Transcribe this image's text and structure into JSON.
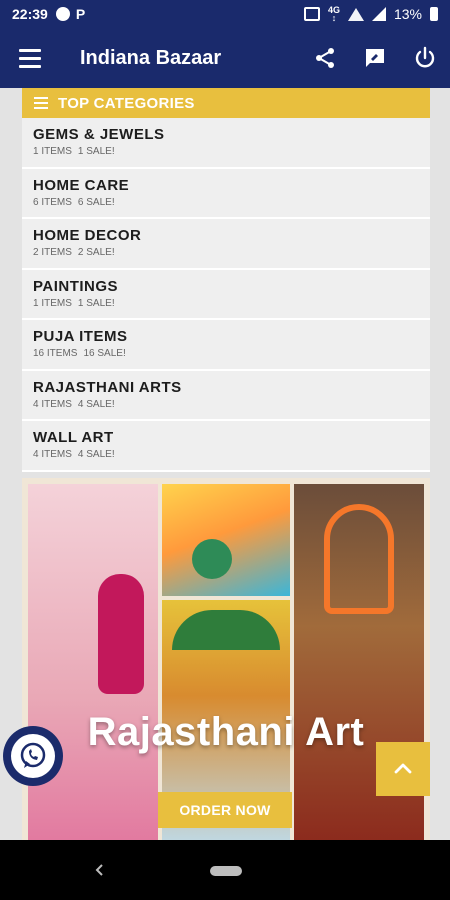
{
  "status_bar": {
    "time": "22:39",
    "battery": "13%"
  },
  "app_bar": {
    "title": "Indiana Bazaar",
    "icons": [
      "menu-icon",
      "share-icon",
      "feedback-icon",
      "power-icon"
    ]
  },
  "categories": {
    "header": "TOP CATEGORIES",
    "items": [
      {
        "name": "GEMS & JEWELS",
        "items": "1 ITEMS",
        "sale": "1 SALE!"
      },
      {
        "name": "HOME CARE",
        "items": "6 ITEMS",
        "sale": "6 SALE!"
      },
      {
        "name": "HOME DECOR",
        "items": "2 ITEMS",
        "sale": "2 SALE!"
      },
      {
        "name": "PAINTINGS",
        "items": "1 ITEMS",
        "sale": "1 SALE!"
      },
      {
        "name": "PUJA ITEMS",
        "items": "16 ITEMS",
        "sale": "16 SALE!"
      },
      {
        "name": "RAJASTHANI ARTS",
        "items": "4 ITEMS",
        "sale": "4 SALE!"
      },
      {
        "name": "WALL ART",
        "items": "4 ITEMS",
        "sale": "4 SALE!"
      }
    ]
  },
  "banner": {
    "title": "Rajasthani Art",
    "button_label": "ORDER NOW"
  },
  "colors": {
    "app_bar": "#1a2a6c",
    "accent": "#e8bf3e"
  }
}
